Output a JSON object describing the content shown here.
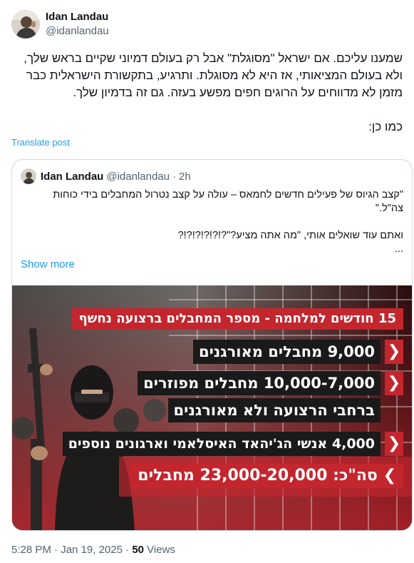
{
  "author": {
    "display_name": "Idan Landau",
    "handle": "@idanlandau",
    "avatar_icon": "profile-photo"
  },
  "tweet": {
    "text": "שמענו עליכם. אם ישראל \"מסוגלת\" אבל רק בעולם דמיוני שקיים בראש שלך,\nולא בעולם המציאותי, אז היא לא מסוגלת. ותרגיע, בתקשורת הישראלית כבר\nמזמן לא מדווחים על הרוגים חפים מפשע בעזה. גם זה בדמיון שלך.\n\nכמו כן:",
    "translate_label": "Translate post"
  },
  "quote": {
    "display_name": "Idan Landau",
    "handle": "@idanlandau",
    "separator": "·",
    "time": "2h",
    "text": "\"קצב הגיוס של פעילים חדשים לחמאס – עולה על קצב נטרול המחבלים בידי כוחות\nצה\"ל.\"\n\nואתם עוד שואלים אותי, \"מה אתה מציע?\"?!?!?!?!?!?\n...",
    "show_more_label": "Show more",
    "image": {
      "title": "15 חודשים למלחמה - מספר המחבלים ברצועה נחשף",
      "stats": [
        "9,000 מחבלים מאורגנים",
        "10,000-7,000 מחבלים מפוזרים",
        "ברחבי הרצועה ולא מאורגנים",
        "4,000 אנשי הג'יהאד האיסלאמי וארגונים נוספים"
      ],
      "total": "סה\"כ: 23,000-20,000 מחבלים",
      "chevron_glyph": "❯",
      "accent_color": "#c4262e",
      "box_color": "#1a1a1a"
    }
  },
  "footer": {
    "time": "5:28 PM",
    "separator": "·",
    "date": "Jan 19, 2025",
    "views_count": "50",
    "views_label": "Views"
  }
}
